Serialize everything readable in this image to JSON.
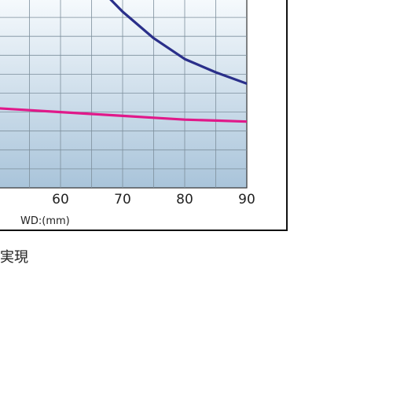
{
  "chart_data": {
    "type": "line",
    "x_tick_labels": [
      "60",
      "70",
      "80",
      "90"
    ],
    "xlabel": "WD:(mm)",
    "xlim": [
      50,
      90
    ],
    "ylim": [
      0,
      10
    ],
    "grid": true,
    "series": [
      {
        "color": "#2a2f8a",
        "x": [
          67,
          70,
          75,
          80,
          85,
          90
        ],
        "y": [
          10.3,
          9.3,
          7.9,
          6.8,
          6.1,
          5.5
        ]
      },
      {
        "color": "#e0198a",
        "x": [
          50,
          55,
          60,
          65,
          70,
          75,
          80,
          85,
          90
        ],
        "y": [
          4.2,
          4.1,
          4.0,
          3.9,
          3.8,
          3.7,
          3.6,
          3.55,
          3.5
        ]
      }
    ]
  },
  "caption": "実現",
  "colors": {
    "plot_top": "#f6fafd",
    "plot_bottom": "#a9c4da",
    "grid": "#7d8f9c"
  }
}
